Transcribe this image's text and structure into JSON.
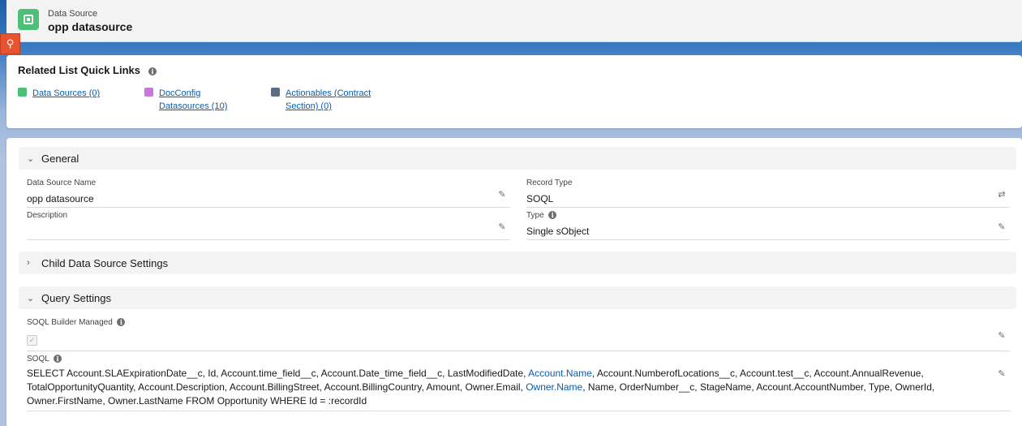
{
  "header": {
    "eyebrow": "Data Source",
    "title": "opp datasource"
  },
  "quick_links": {
    "title": "Related List Quick Links",
    "items": [
      {
        "label": "Data Sources (0)",
        "icon": "datasource-icon",
        "color": "#4bc076"
      },
      {
        "label": "DocConfig Datasources (10)",
        "icon": "docconfig-icon",
        "color": "#c779d6"
      },
      {
        "label": "Actionables (Contract Section) (0)",
        "icon": "wrench-icon",
        "color": "#5d6d84"
      }
    ]
  },
  "sections": {
    "general": "General",
    "child": "Child Data Source Settings",
    "query": "Query Settings"
  },
  "fields": {
    "name": {
      "label": "Data Source Name",
      "value": "opp datasource"
    },
    "record_type": {
      "label": "Record Type",
      "value": "SOQL"
    },
    "description": {
      "label": "Description",
      "value": ""
    },
    "type": {
      "label": "Type",
      "value": "Single sObject"
    },
    "soql_builder_managed": {
      "label": "SOQL Builder Managed",
      "checked": true
    },
    "soql": {
      "label": "SOQL",
      "parts": [
        "SELECT Account.SLAExpirationDate__c, Id, Account.time_field__c, Account.Date_time_field__c, LastModifiedDate, ",
        "Account.Name",
        ", Account.NumberofLocations__c, Account.test__c, Account.AnnualRevenue, TotalOpportunityQuantity, Account.Description, Account.BillingStreet, Account.BillingCountry, Amount, Owner.Email, ",
        "Owner.Name",
        ", Name, OrderNumber__c, StageName, Account.AccountNumber, Type, OwnerId, Owner.FirstName, Owner.LastName FROM Opportunity WHERE Id = :recordId"
      ]
    }
  }
}
